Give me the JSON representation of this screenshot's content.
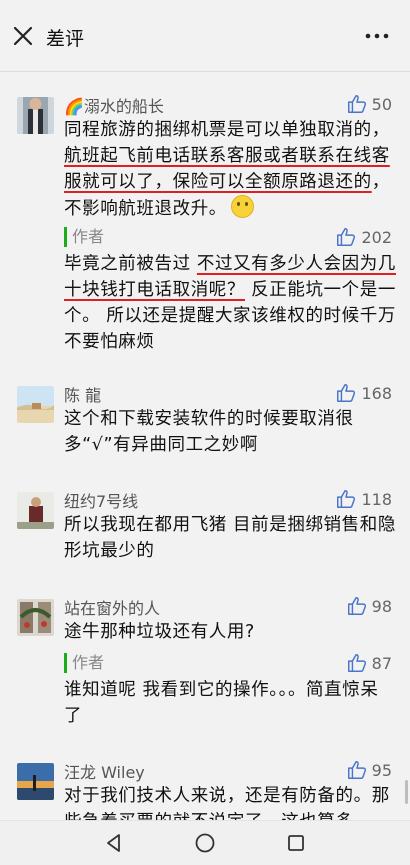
{
  "header": {
    "title": "差评"
  },
  "comments": [
    {
      "user": "🌈溺水的船长",
      "likes": "50",
      "text": {
        "p1": "同程旅游的捆绑机票是可以单独取消的，",
        "u1": "航班起飞前电话联系客服或者联系在线客服就可以了，保险可以全额原路退还的",
        "p2": "，不影响航班退改升。"
      },
      "reply": {
        "label": "作者",
        "likes": "202",
        "p1": "毕竟之前被告过 ",
        "u1": "不过又有多少人会因为几十块钱打电话取消呢？",
        "p2": " 反正能坑一个是一个。 所以还是提醒大家该维权的时候千万不要怕麻烦"
      }
    },
    {
      "user": "陈 龍",
      "likes": "168",
      "text": "这个和下载安装软件的时候要取消很多“√”有异曲同工之妙啊"
    },
    {
      "user": "纽约7号线",
      "likes": "118",
      "text": "所以我现在都用飞猪 目前是捆绑销售和隐形坑最少的"
    },
    {
      "user": "站在窗外的人",
      "likes": "98",
      "text": "途牛那种垃圾还有人用?",
      "reply": {
        "label": "作者",
        "likes": "87",
        "text": "谁知道呢 我看到它的操作。。。简直惊呆了"
      }
    },
    {
      "user": "汪龙 Wiley",
      "likes": "95",
      "text": "对于我们技术人来说，还是有防备的。那些急着买票的就不说定了，这也算多"
    }
  ],
  "colors": {
    "underline": "#e02020",
    "link_blue": "#4a74c9",
    "author_green": "#1aad19"
  },
  "icons": [
    "close-icon",
    "more-icon",
    "thumbs-up-icon",
    "nav-back-icon",
    "nav-home-icon",
    "nav-recent-icon"
  ]
}
